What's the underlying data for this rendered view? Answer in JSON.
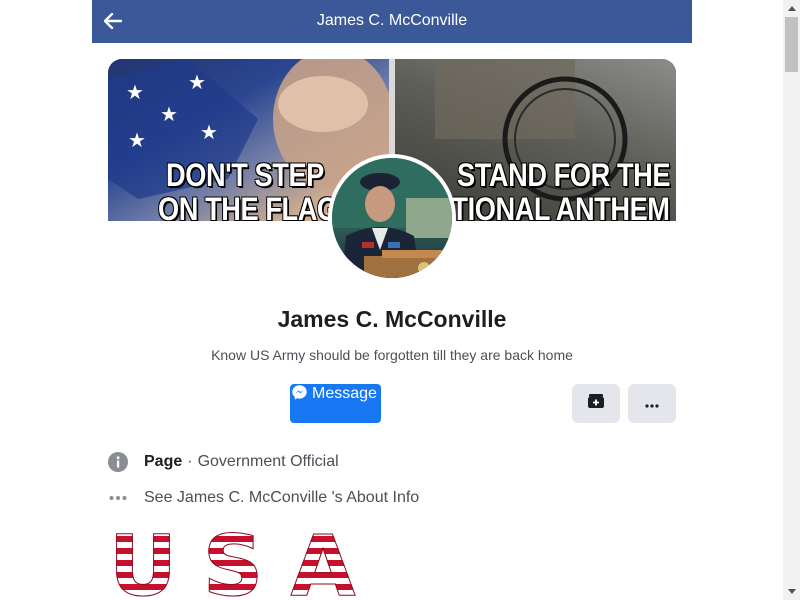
{
  "header": {
    "title": "James C. McConville",
    "back_icon": "arrow-left-icon"
  },
  "cover": {
    "left_text_1": "DON'T STEP",
    "left_text_2": "ON THE FLAG",
    "right_text_1": "STAND FOR THE",
    "right_text_2": "NATIONAL ANTHEM"
  },
  "profile": {
    "name": "James C. McConville",
    "bio": "Know US Army should be forgotten till they are back home"
  },
  "actions": {
    "message_label": "Message",
    "message_icon": "messenger-icon",
    "save_icon": "bookmark-plus-icon",
    "more_icon": "more-icon"
  },
  "info": {
    "page_label": "Page",
    "page_category": "Government Official",
    "about_text": "See James C. McConville 's About Info"
  },
  "photos": [
    "U",
    "S",
    "A"
  ],
  "colors": {
    "header_bg": "#3b5998",
    "message_btn": "#1877f2",
    "icon_btn_bg": "#e4e6eb"
  }
}
